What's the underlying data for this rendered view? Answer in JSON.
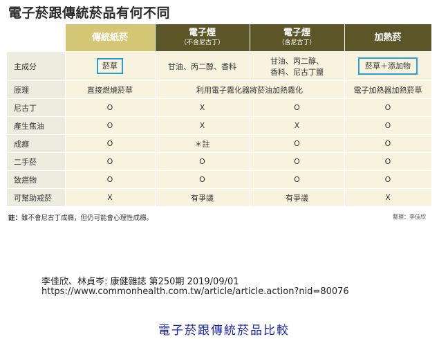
{
  "title": "電子菸跟傳統菸品有何不同",
  "columns": [
    {
      "label": "傳統紙菸",
      "sub": ""
    },
    {
      "label": "電子煙",
      "sub": "（不含尼古丁）"
    },
    {
      "label": "電子煙",
      "sub": "（含尼古丁）"
    },
    {
      "label": "加熱菸",
      "sub": ""
    }
  ],
  "rows": {
    "main": {
      "label": "主成分",
      "c1": "菸草",
      "c2": "甘油、丙二醇、香料",
      "c3a": "甘油、丙二醇、",
      "c3b": "香料、尼古丁鹽",
      "c4": "菸草＋添加物"
    },
    "principle": {
      "label": "原理",
      "c1": "直接燃燒菸草",
      "c23": "利用電子霧化器將菸油加熱霧化",
      "c4": "電子加熱器加熱菸草"
    },
    "nicotine": {
      "label": "尼古丁",
      "c1": "O",
      "c2": "X",
      "c3": "O",
      "c4": "O"
    },
    "tar": {
      "label": "產生焦油",
      "c1": "O",
      "c2": "X",
      "c3": "X",
      "c4": "O"
    },
    "addiction": {
      "label": "成癮",
      "c1": "O",
      "c2": "＊註",
      "c3": "O",
      "c4": "O"
    },
    "secondhand": {
      "label": "二手菸",
      "c1": "O",
      "c2": "O",
      "c3": "O",
      "c4": "O"
    },
    "carcinogen": {
      "label": "致癌物",
      "c1": "O",
      "c2": "O",
      "c3": "O",
      "c4": "O"
    },
    "quit": {
      "label": "可幫助戒菸",
      "c1": "X",
      "c2": "有爭議",
      "c3": "有爭議",
      "c4": "X"
    }
  },
  "note_prefix": "註：",
  "note_text": "雖不會尼古丁成癮，但仍可能會心理性成癮。",
  "credit": "整理：李佳欣",
  "citation_line1": "李佳欣、林貞岑: 康健雜誌 第250期 2019/09/01",
  "citation_line2": "https://www.commonhealth.com.tw/article/article.action?nid=80076",
  "caption": "電子菸跟傳統菸品比較",
  "colors": {
    "header": "#5b5528",
    "header_first": "#d3c776",
    "cell": "#f7f3df",
    "row_label": "#ececdf",
    "highlight_box": "#2a9fd6",
    "caption": "#1a23b8"
  }
}
